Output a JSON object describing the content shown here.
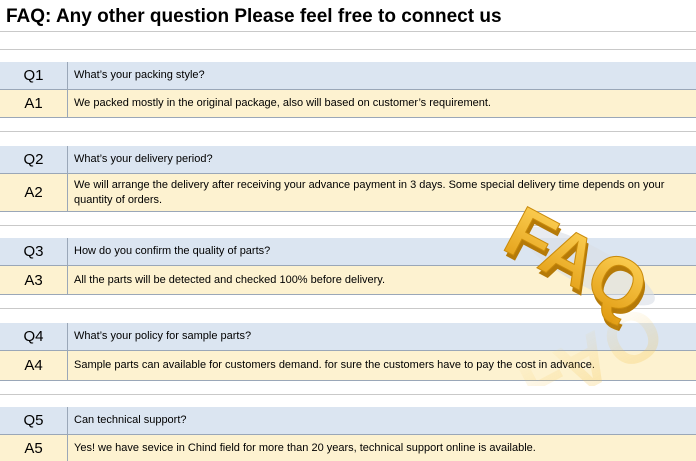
{
  "page": {
    "title": "FAQ:  Any other question Please feel free to connect us",
    "logo_text": "FAQ"
  },
  "faqs": [
    {
      "q_label": "Q1",
      "question": "What’s your packing style?",
      "a_label": "A1",
      "answer": "We packed mostly in the original package, also will based on customer’s requirement."
    },
    {
      "q_label": "Q2",
      "question": "What’s your delivery period?",
      "a_label": "A2",
      "answer": "We will arrange the delivery after receiving your advance payment in 3 days. Some special delivery time depends on your quantity of orders."
    },
    {
      "q_label": "Q3",
      "question": "How do you confirm the quality of parts?",
      "a_label": "A3",
      "answer": "All the parts will be detected and checked 100% before delivery."
    },
    {
      "q_label": "Q4",
      "question": "What’s your policy for  sample parts?",
      "a_label": "A4",
      "answer": "Sample parts can available for customers demand. for sure the customers have to pay the cost  in advance."
    },
    {
      "q_label": "Q5",
      "question": "Can technical support?",
      "a_label": "A5",
      "answer": "Yes! we have sevice in Chind field for more than 20 years, technical support online is available."
    }
  ],
  "colors": {
    "question_bg": "#dbe5f1",
    "answer_bg": "#fdf2d0",
    "logo": "#f0b21c"
  }
}
